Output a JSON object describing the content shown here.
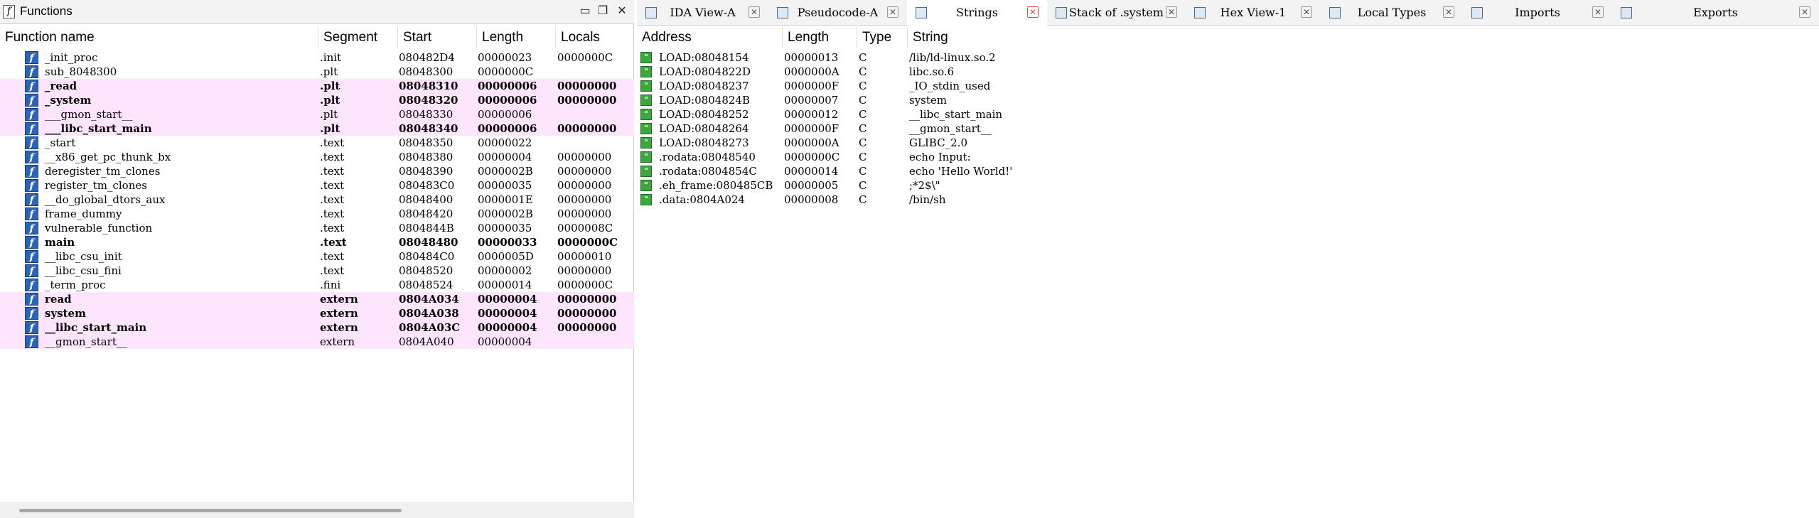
{
  "functions_window": {
    "title": "Functions",
    "columns": [
      "Function name",
      "Segment",
      "Start",
      "Length",
      "Locals"
    ],
    "rows": [
      {
        "name": "_init_proc",
        "segment": ".init",
        "start": "080482D4",
        "length": "00000023",
        "locals": "0000000C",
        "highlight": false,
        "bold": false
      },
      {
        "name": "sub_8048300",
        "segment": ".plt",
        "start": "08048300",
        "length": "0000000C",
        "locals": "",
        "highlight": false,
        "bold": false
      },
      {
        "name": "_read",
        "segment": ".plt",
        "start": "08048310",
        "length": "00000006",
        "locals": "00000000",
        "highlight": true,
        "bold": true
      },
      {
        "name": "_system",
        "segment": ".plt",
        "start": "08048320",
        "length": "00000006",
        "locals": "00000000",
        "highlight": true,
        "bold": true
      },
      {
        "name": "___gmon_start__",
        "segment": ".plt",
        "start": "08048330",
        "length": "00000006",
        "locals": "",
        "highlight": true,
        "bold": false
      },
      {
        "name": "___libc_start_main",
        "segment": ".plt",
        "start": "08048340",
        "length": "00000006",
        "locals": "00000000",
        "highlight": true,
        "bold": true
      },
      {
        "name": "_start",
        "segment": ".text",
        "start": "08048350",
        "length": "00000022",
        "locals": "",
        "highlight": false,
        "bold": false
      },
      {
        "name": "__x86_get_pc_thunk_bx",
        "segment": ".text",
        "start": "08048380",
        "length": "00000004",
        "locals": "00000000",
        "highlight": false,
        "bold": false
      },
      {
        "name": "deregister_tm_clones",
        "segment": ".text",
        "start": "08048390",
        "length": "0000002B",
        "locals": "00000000",
        "highlight": false,
        "bold": false
      },
      {
        "name": "register_tm_clones",
        "segment": ".text",
        "start": "080483C0",
        "length": "00000035",
        "locals": "00000000",
        "highlight": false,
        "bold": false
      },
      {
        "name": "__do_global_dtors_aux",
        "segment": ".text",
        "start": "08048400",
        "length": "0000001E",
        "locals": "00000000",
        "highlight": false,
        "bold": false
      },
      {
        "name": "frame_dummy",
        "segment": ".text",
        "start": "08048420",
        "length": "0000002B",
        "locals": "00000000",
        "highlight": false,
        "bold": false
      },
      {
        "name": "vulnerable_function",
        "segment": ".text",
        "start": "0804844B",
        "length": "00000035",
        "locals": "0000008C",
        "highlight": false,
        "bold": false
      },
      {
        "name": "main",
        "segment": ".text",
        "start": "08048480",
        "length": "00000033",
        "locals": "0000000C",
        "highlight": false,
        "bold": true
      },
      {
        "name": "__libc_csu_init",
        "segment": ".text",
        "start": "080484C0",
        "length": "0000005D",
        "locals": "00000010",
        "highlight": false,
        "bold": false
      },
      {
        "name": "__libc_csu_fini",
        "segment": ".text",
        "start": "08048520",
        "length": "00000002",
        "locals": "00000000",
        "highlight": false,
        "bold": false
      },
      {
        "name": "_term_proc",
        "segment": ".fini",
        "start": "08048524",
        "length": "00000014",
        "locals": "0000000C",
        "highlight": false,
        "bold": false
      },
      {
        "name": "read",
        "segment": "extern",
        "start": "0804A034",
        "length": "00000004",
        "locals": "00000000",
        "highlight": true,
        "bold": true
      },
      {
        "name": "system",
        "segment": "extern",
        "start": "0804A038",
        "length": "00000004",
        "locals": "00000000",
        "highlight": true,
        "bold": true
      },
      {
        "name": "__libc_start_main",
        "segment": "extern",
        "start": "0804A03C",
        "length": "00000004",
        "locals": "00000000",
        "highlight": true,
        "bold": true
      },
      {
        "name": "__gmon_start__",
        "segment": "extern",
        "start": "0804A040",
        "length": "00000004",
        "locals": "",
        "highlight": true,
        "bold": false
      }
    ]
  },
  "tabs": [
    {
      "label": "IDA View-A",
      "active": false,
      "icon": "ida-view-icon"
    },
    {
      "label": "Pseudocode-A",
      "active": false,
      "icon": "pseudocode-icon"
    },
    {
      "label": "Strings",
      "active": true,
      "icon": "strings-icon"
    },
    {
      "label": "Stack of .system",
      "active": false,
      "icon": "stack-icon"
    },
    {
      "label": "Hex View-1",
      "active": false,
      "icon": "hex-view-icon"
    },
    {
      "label": "Local Types",
      "active": false,
      "icon": "local-types-icon"
    },
    {
      "label": "Imports",
      "active": false,
      "icon": "imports-icon"
    },
    {
      "label": "Exports",
      "active": false,
      "icon": "exports-icon"
    }
  ],
  "strings_window": {
    "columns": [
      "Address",
      "Length",
      "Type",
      "String"
    ],
    "rows": [
      {
        "address": "LOAD:08048154",
        "length": "00000013",
        "type": "C",
        "string": "/lib/ld-linux.so.2"
      },
      {
        "address": "LOAD:0804822D",
        "length": "0000000A",
        "type": "C",
        "string": "libc.so.6"
      },
      {
        "address": "LOAD:08048237",
        "length": "0000000F",
        "type": "C",
        "string": "_IO_stdin_used"
      },
      {
        "address": "LOAD:0804824B",
        "length": "00000007",
        "type": "C",
        "string": "system"
      },
      {
        "address": "LOAD:08048252",
        "length": "00000012",
        "type": "C",
        "string": "__libc_start_main"
      },
      {
        "address": "LOAD:08048264",
        "length": "0000000F",
        "type": "C",
        "string": "__gmon_start__"
      },
      {
        "address": "LOAD:08048273",
        "length": "0000000A",
        "type": "C",
        "string": "GLIBC_2.0"
      },
      {
        "address": ".rodata:08048540",
        "length": "0000000C",
        "type": "C",
        "string": "echo Input:"
      },
      {
        "address": ".rodata:0804854C",
        "length": "00000014",
        "type": "C",
        "string": "echo 'Hello World!'"
      },
      {
        "address": ".eh_frame:080485CB",
        "length": "00000005",
        "type": "C",
        "string": ";*2$\\\""
      },
      {
        "address": ".data:0804A024",
        "length": "00000008",
        "type": "C",
        "string": "/bin/sh"
      }
    ]
  },
  "colors": {
    "highlight_row": "#fde6fd",
    "function_icon": "#2a64b8",
    "string_icon": "#3aa83a"
  }
}
